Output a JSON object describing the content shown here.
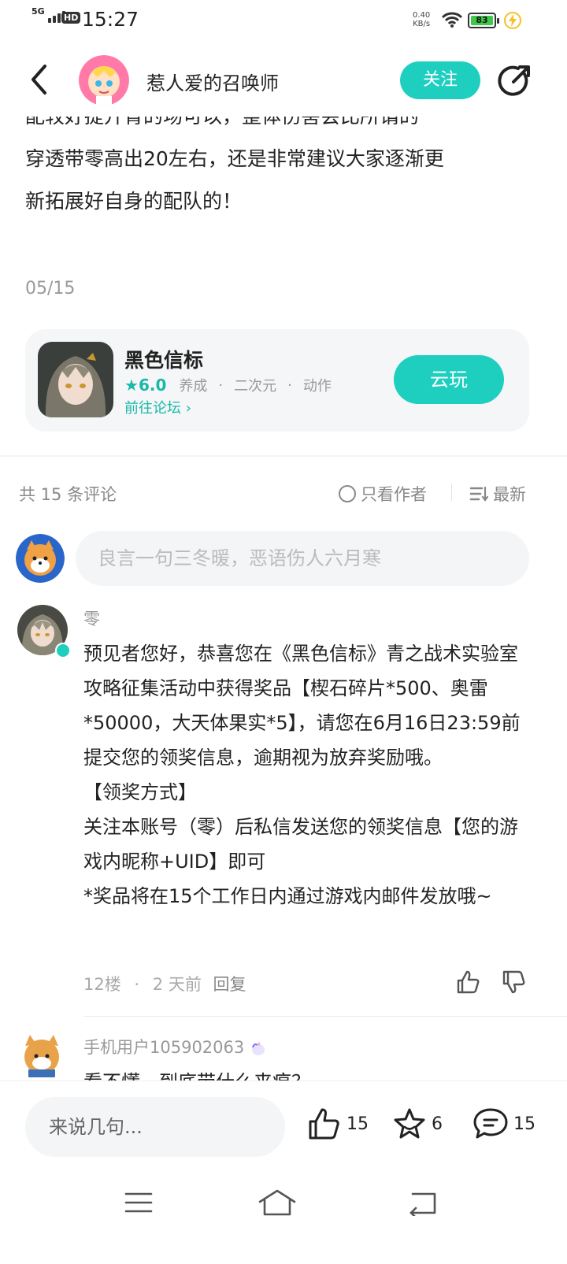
{
  "status_bar": {
    "network": "5G",
    "hd": "HD",
    "time": "15:27",
    "net_speed": "0.40",
    "net_unit": "KB/s",
    "battery": "83"
  },
  "header": {
    "author": "惹人爱的召唤师",
    "follow_label": "关注"
  },
  "article": {
    "lines": [
      "配较好提升青的场可以，整体伤害会比所谓的",
      "穿透带零高出20左右，还是非常建议大家逐渐更",
      "新拓展好自身的配队的！"
    ],
    "date": "05/15"
  },
  "game_card": {
    "name": "黑色信标",
    "score": "6.0",
    "tags": [
      "养成",
      "二次元",
      "动作"
    ],
    "separator": "·",
    "forum_link": "前往论坛",
    "cloud_button": "云玩"
  },
  "comments_header": {
    "count": "共 15 条评论",
    "only_author": "只看作者",
    "sort": "最新"
  },
  "comment_input": {
    "placeholder": "良言一句三冬暖，恶语伤人六月寒"
  },
  "comments": [
    {
      "name": "零",
      "paragraphs": [
        "预见者您好，恭喜您在《黑色信标》青之战术实验室攻略征集活动中获得奖品【楔石碎片*500、奥雷*50000，大天体果实*5】，请您在6月16日23:59前提交您的领奖信息，逾期视为放弃奖励哦。",
        "【领奖方式】",
        "关注本账号（零）后私信发送您的领奖信息【您的游戏内昵称+UID】即可",
        "*奖品将在15个工作日内通过游戏内邮件发放哦~"
      ],
      "floor": "12楼",
      "separator": "·",
      "time": "2 天前",
      "reply": "回复"
    },
    {
      "name": "手机用户105902063",
      "text": "看不懂，到底带什么来痕？"
    }
  ],
  "bottom_bar": {
    "say_placeholder": "来说几句...",
    "likes": "15",
    "favorites": "6",
    "comments": "15"
  },
  "colors": {
    "accent": "#1ecfc0",
    "accent_text": "#1ab8aa"
  }
}
